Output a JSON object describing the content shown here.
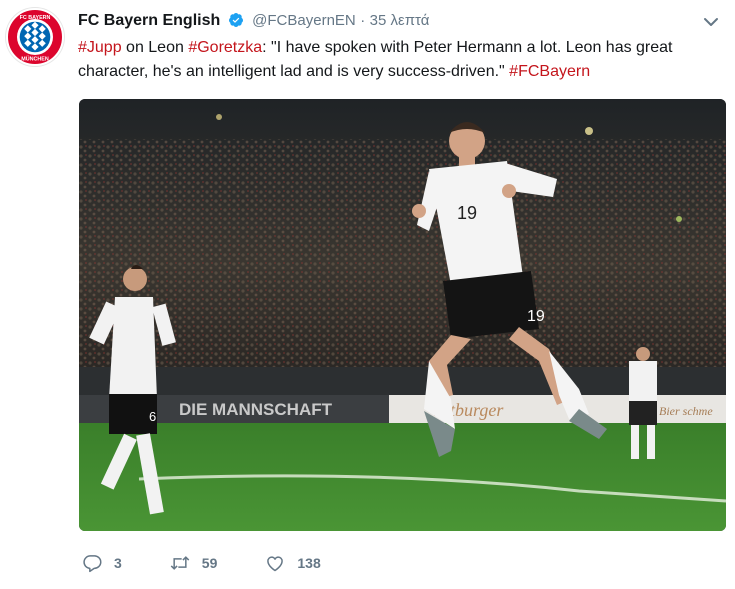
{
  "tweet": {
    "author_name": "FC Bayern English",
    "handle": "@FCBayernEN",
    "separator": "·",
    "time": "35 λεπτά",
    "text_parts": [
      {
        "text": "#Jupp",
        "type": "tag"
      },
      {
        "text": " on Leon ",
        "type": "plain"
      },
      {
        "text": "#Goretzka",
        "type": "tag"
      },
      {
        "text": ": \"I have spoken with Peter Hermann a lot. Leon has great character, he's an intelligent lad and is very success-driven.\" ",
        "type": "plain"
      },
      {
        "text": "#FCBayern",
        "type": "tag"
      }
    ],
    "avatar": {
      "logo_text_top": "FC BAYERN",
      "logo_text_bottom": "MÜNCHEN",
      "icon": "fc-bayern-logo"
    },
    "media": {
      "banner_left": "DIE MANNSCHAFT",
      "banner_right": "Bitburger",
      "banner_far_right": "Bier schme",
      "player_main_number": "19",
      "player_left_number": "6"
    }
  },
  "actions": {
    "reply_count": "3",
    "retweet_count": "59",
    "like_count": "138"
  },
  "colors": {
    "hashtag": "#c4151c",
    "verified": "#1da1f2",
    "muted": "#657786",
    "bayern_red": "#dc052d",
    "pitch": "#3f8a2e"
  }
}
